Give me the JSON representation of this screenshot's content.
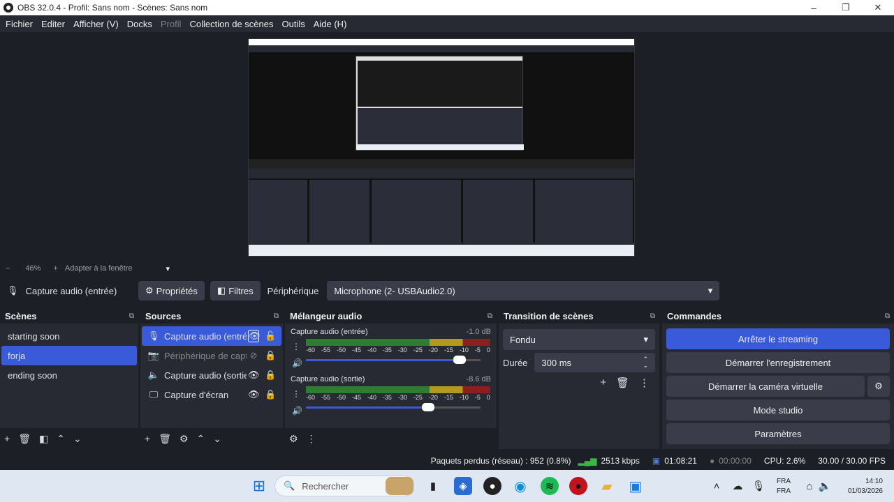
{
  "window": {
    "title": "OBS 32.0.4 - Profil: Sans nom - Scènes: Sans nom",
    "minimize": "–",
    "maximize": "❐",
    "close": "✕"
  },
  "menu": [
    "Fichier",
    "Editer",
    "Afficher (V)",
    "Docks",
    "Profil",
    "Collection de scènes",
    "Outils",
    "Aide (H)"
  ],
  "zoom": {
    "minus": "−",
    "value": "46%",
    "plus": "+",
    "fit": "Adapter à la fenêtre",
    "caret": "▾"
  },
  "source_bar": {
    "selected": "Capture audio (entrée)",
    "properties": "Propriétés",
    "filters": "Filtres",
    "device_label": "Périphérique",
    "device_value": "Microphone (2- USBAudio2.0)"
  },
  "scenes": {
    "title": "Scènes",
    "items": [
      "starting soon",
      "forja",
      "ending soon"
    ],
    "selected": 1
  },
  "sources": {
    "title": "Sources",
    "items": [
      {
        "name": "Capture audio (entrée)",
        "icon": "mic-icon"
      },
      {
        "name": "Périphérique de capture vidéo",
        "icon": "camera-icon"
      },
      {
        "name": "Capture audio (sortie)",
        "icon": "speaker-icon"
      },
      {
        "name": "Capture d'écran",
        "icon": "monitor-icon"
      }
    ]
  },
  "mixer": {
    "title": "Mélangeur audio",
    "channels": [
      {
        "name": "Capture audio (entrée)",
        "db": "-1.0 dB",
        "level": 0.88
      },
      {
        "name": "Capture audio (sortie)",
        "db": "-8.6 dB",
        "level": 0.7
      }
    ],
    "ticks": [
      "-60",
      "-55",
      "-50",
      "-45",
      "-40",
      "-35",
      "-30",
      "-25",
      "-20",
      "-15",
      "-10",
      "-5",
      "0"
    ]
  },
  "transition": {
    "title": "Transition de scènes",
    "type": "Fondu",
    "duration_label": "Durée",
    "duration": "300 ms"
  },
  "commands": {
    "title": "Commandes",
    "buttons": [
      "Arrêter le streaming",
      "Démarrer l'enregistrement",
      "Démarrer la caméra virtuelle",
      "Mode studio",
      "Paramètres"
    ]
  },
  "status": {
    "dropped": "Paquets perdus (réseau) : 952 (0.8%)",
    "bitrate": "2513 kbps",
    "stream_time": "01:08:21",
    "rec_time": "00:00:00",
    "cpu": "CPU: 2.6%",
    "fps": "30.00 / 30.00 FPS"
  },
  "taskbar": {
    "search": "Rechercher",
    "lang1": "FRA",
    "lang2": "FRA",
    "time": "14:10",
    "date": "01/03/2026"
  },
  "colors": {
    "accent": "#3a5bd9",
    "panel": "#272a33",
    "bg": "#1d1f26"
  }
}
